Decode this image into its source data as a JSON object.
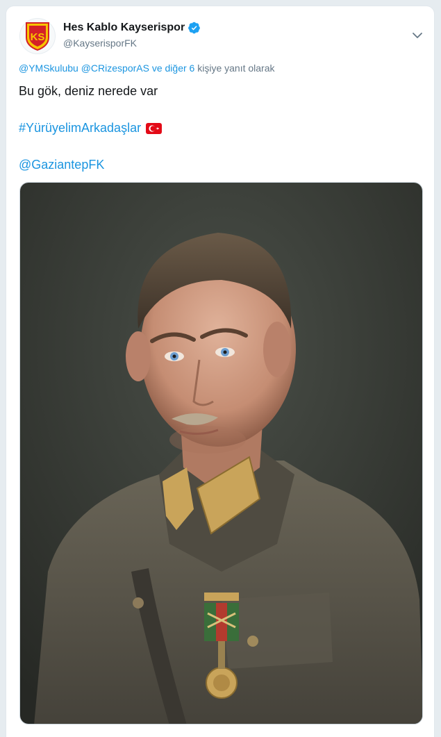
{
  "tweet": {
    "display_name": "Hes Kablo Kayserispor",
    "handle": "@KayserisporFK",
    "verified_icon": "verified-badge-icon",
    "avatar_logo_text": "KS",
    "reply_to": {
      "mention_1": "@YMSkulubu",
      "mention_2": "@CRizesporAS",
      "others": "ve diğer 6",
      "suffix": "kişiye yanıt olarak"
    },
    "text": "Bu gök, deniz nerede var",
    "hashtag": "#YürüyelimArkadaşlar",
    "hashtag_emoji": "turkey-flag-icon",
    "mention": "@GaziantepFK",
    "more_icon": "chevron-down-icon"
  },
  "colors": {
    "link": "#1b95e0",
    "text": "#14171a",
    "secondary": "#657786",
    "verified": "#1da1f2",
    "logo_red": "#d42127",
    "logo_yellow": "#f7c400"
  }
}
